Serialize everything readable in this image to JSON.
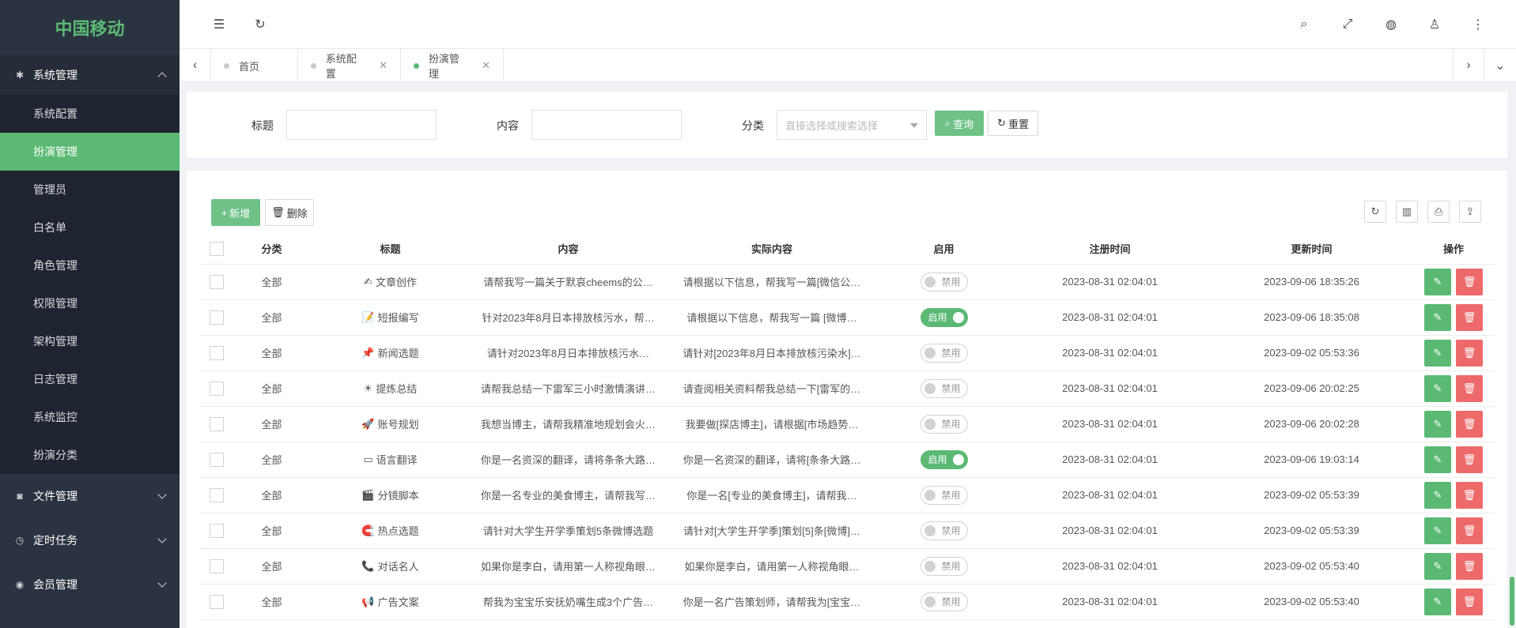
{
  "brand": "中国移动",
  "sidebar": {
    "groups": [
      {
        "label": "系统管理",
        "icon": "gear-icon",
        "expanded": true,
        "items": [
          "系统配置",
          "扮演管理",
          "管理员",
          "白名单",
          "角色管理",
          "权限管理",
          "架构管理",
          "日志管理",
          "系统监控",
          "扮演分类"
        ],
        "active": "扮演管理"
      },
      {
        "label": "文件管理",
        "icon": "camera-icon",
        "expanded": false
      },
      {
        "label": "定时任务",
        "icon": "clock-icon",
        "expanded": false
      },
      {
        "label": "会员管理",
        "icon": "member-icon",
        "expanded": false
      }
    ]
  },
  "tabs": [
    {
      "label": "首页",
      "closable": false,
      "active": false
    },
    {
      "label": "系统配置",
      "closable": true,
      "active": false
    },
    {
      "label": "扮演管理",
      "closable": true,
      "active": true
    }
  ],
  "search": {
    "title_label": "标题",
    "content_label": "内容",
    "category_label": "分类",
    "category_placeholder": "直接选择或搜索选择",
    "query_label": "查询",
    "reset_label": "重置"
  },
  "toolbar": {
    "add_label": "新增",
    "delete_label": "删除"
  },
  "table": {
    "headers": [
      "分类",
      "标题",
      "内容",
      "实际内容",
      "启用",
      "注册时间",
      "更新时间",
      "操作"
    ],
    "rows": [
      {
        "category": "全部",
        "icon": "✍",
        "title": "文章创作",
        "content": "请帮我写一篇关于默哀cheems的公…",
        "actual": "请根据以下信息，帮我写一篇[微信公…",
        "enabled": false,
        "reg": "2023-08-31 02:04:01",
        "upd": "2023-09-06 18:35:26"
      },
      {
        "category": "全部",
        "icon": "📝",
        "title": "短报编写",
        "content": "针对2023年8月日本排放核污水，帮…",
        "actual": "请根据以下信息，帮我写一篇 [微博…",
        "enabled": true,
        "reg": "2023-08-31 02:04:01",
        "upd": "2023-09-06 18:35:08"
      },
      {
        "category": "全部",
        "icon": "📌",
        "title": "新闻选题",
        "content": "请针对2023年8月日本排放核污水…",
        "actual": "请针对[2023年8月日本排放核污染水]…",
        "enabled": false,
        "reg": "2023-08-31 02:04:01",
        "upd": "2023-09-02 05:53:36"
      },
      {
        "category": "全部",
        "icon": "☀",
        "title": "提炼总结",
        "content": "请帮我总结一下雷军三小时激情演讲…",
        "actual": "请查阅相关资料帮我总结一下[雷军的…",
        "enabled": false,
        "reg": "2023-08-31 02:04:01",
        "upd": "2023-09-06 20:02:25"
      },
      {
        "category": "全部",
        "icon": "🚀",
        "title": "账号规划",
        "content": "我想当博主，请帮我精准地规划会火…",
        "actual": "我要做[探店博主]，请根据[市场趋势…",
        "enabled": false,
        "reg": "2023-08-31 02:04:01",
        "upd": "2023-09-06 20:02:28"
      },
      {
        "category": "全部",
        "icon": "▭",
        "title": "语言翻译",
        "content": "你是一名资深的翻译，请将条条大路…",
        "actual": "你是一名资深的翻译，请将[条条大路…",
        "enabled": true,
        "reg": "2023-08-31 02:04:01",
        "upd": "2023-09-06 19:03:14"
      },
      {
        "category": "全部",
        "icon": "🎬",
        "title": "分镜脚本",
        "content": "你是一名专业的美食博主，请帮我写…",
        "actual": "你是一名[专业的美食博主]，请帮我…",
        "enabled": false,
        "reg": "2023-08-31 02:04:01",
        "upd": "2023-09-02 05:53:39"
      },
      {
        "category": "全部",
        "icon": "🧲",
        "title": "热点选题",
        "content": "请针对大学生开学季策划5条微博选题",
        "actual": "请针对[大学生开学季]策划[5]条[微博]…",
        "enabled": false,
        "reg": "2023-08-31 02:04:01",
        "upd": "2023-09-02 05:53:39"
      },
      {
        "category": "全部",
        "icon": "📞",
        "title": "对话名人",
        "content": "如果你是李白，请用第一人称视角眼…",
        "actual": "如果你是李白，请用第一人称视角眼…",
        "enabled": false,
        "reg": "2023-08-31 02:04:01",
        "upd": "2023-09-02 05:53:40"
      },
      {
        "category": "全部",
        "icon": "📢",
        "title": "广告文案",
        "content": "帮我为宝宝乐安抚奶嘴生成3个广告…",
        "actual": "你是一名广告策划师，请帮我为[宝宝…",
        "enabled": false,
        "reg": "2023-08-31 02:04:01",
        "upd": "2023-09-02 05:53:40"
      }
    ],
    "on_label": "启用",
    "off_label": "禁用"
  },
  "colors": {
    "accent": "#5bb974",
    "danger": "#ee6a6a",
    "sidebar": "#2b3340"
  }
}
